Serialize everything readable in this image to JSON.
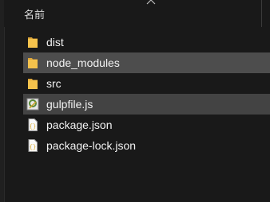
{
  "header": {
    "column_name": "名前"
  },
  "files": [
    {
      "label": "dist",
      "icon": "folder-icon",
      "state": "normal"
    },
    {
      "label": "node_modules",
      "icon": "folder-icon",
      "state": "hover"
    },
    {
      "label": "src",
      "icon": "folder-icon",
      "state": "normal"
    },
    {
      "label": "gulpfile.js",
      "icon": "javascript-file-icon",
      "state": "selected"
    },
    {
      "label": "package.json",
      "icon": "json-file-icon",
      "state": "normal"
    },
    {
      "label": "package-lock.json",
      "icon": "json-file-icon",
      "state": "normal"
    }
  ],
  "colors": {
    "background": "#191919",
    "hover_row": "#4d4d4d",
    "selected_row": "#434343",
    "folder": "#f4c24c"
  }
}
